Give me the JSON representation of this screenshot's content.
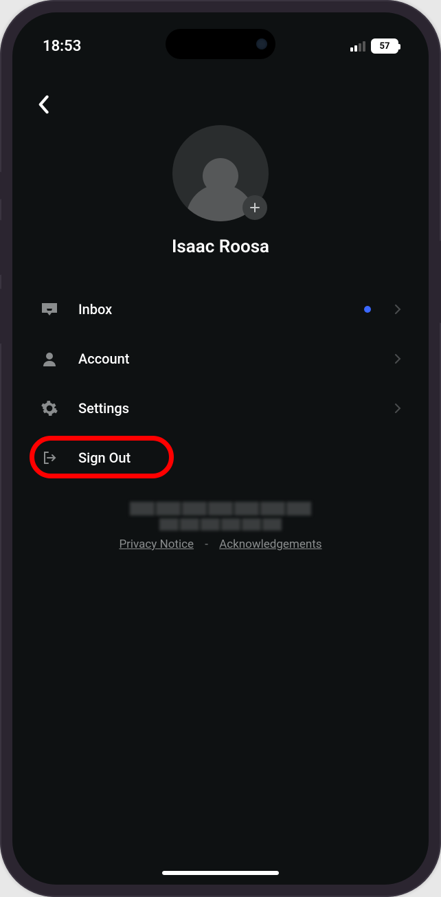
{
  "status": {
    "time": "18:53",
    "battery": "57"
  },
  "profile": {
    "name": "Isaac Roosa"
  },
  "menu": {
    "inbox": "Inbox",
    "account": "Account",
    "settings": "Settings",
    "signout": "Sign Out"
  },
  "footer": {
    "privacy": "Privacy Notice",
    "acknowledgements": "Acknowledgements",
    "separator": "-"
  }
}
